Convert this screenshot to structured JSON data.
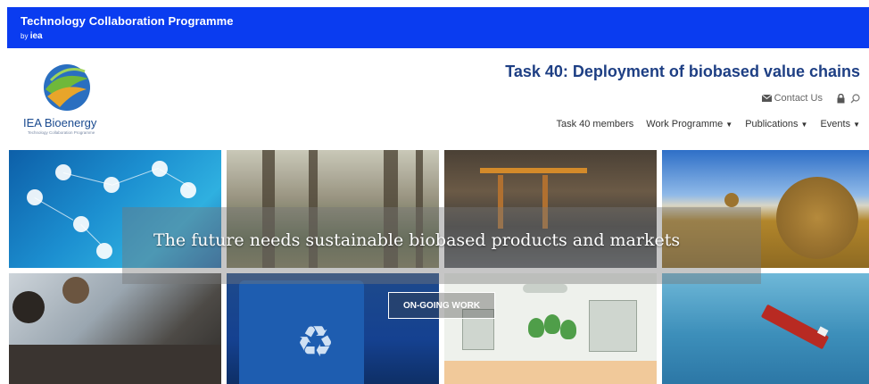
{
  "top_banner": {
    "title": "Technology Collaboration Programme",
    "by_prefix": "by",
    "by_brand": "iea"
  },
  "logo": {
    "name": "IEA Bioenergy",
    "subtitle": "Technology Collaboration Programme"
  },
  "header": {
    "task_title": "Task 40: Deployment of biobased value chains",
    "contact_label": "Contact Us"
  },
  "nav": {
    "items": [
      {
        "label": "Task 40 members",
        "has_dropdown": false
      },
      {
        "label": "Work Programme",
        "has_dropdown": true
      },
      {
        "label": "Publications",
        "has_dropdown": true
      },
      {
        "label": "Events",
        "has_dropdown": true
      }
    ]
  },
  "hero": {
    "headline": "The future needs sustainable biobased products and markets",
    "button_label": "ON-GOING WORK"
  },
  "colors": {
    "banner_blue": "#0a3cf0",
    "title_navy": "#1e3f84"
  },
  "icons": [
    "envelope-icon",
    "lock-icon",
    "search-icon",
    "chevron-down-icon"
  ]
}
